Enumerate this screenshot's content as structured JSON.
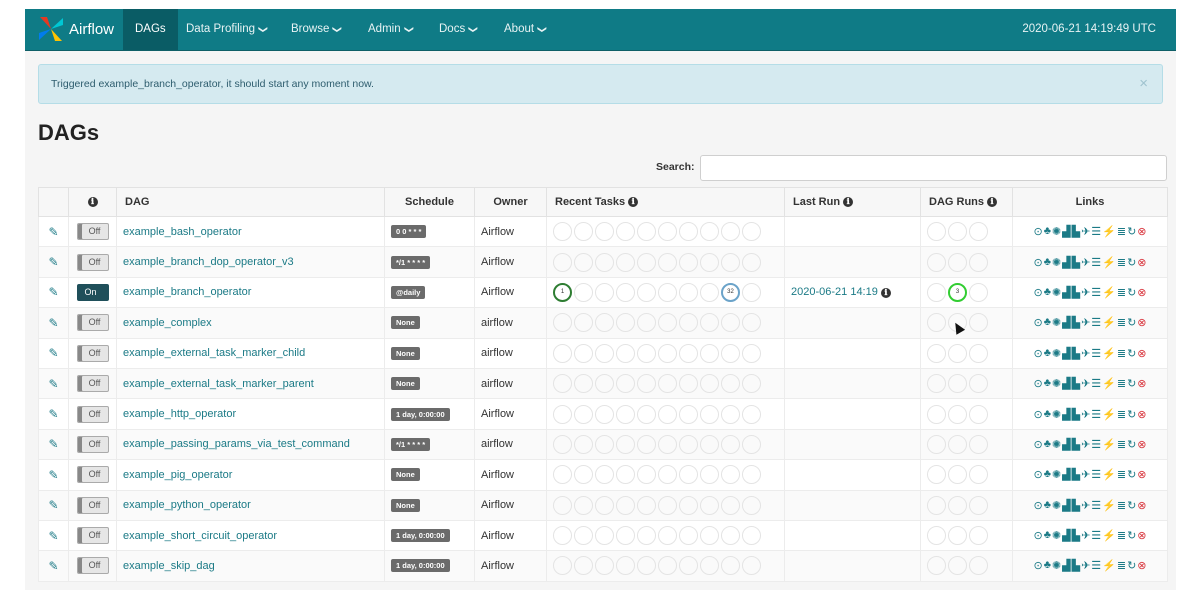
{
  "navbar": {
    "brand": "Airflow",
    "items": [
      {
        "label": "DAGs",
        "caret": ""
      },
      {
        "label": "Data Profiling",
        "caret": "❯"
      },
      {
        "label": "Browse",
        "caret": "❯"
      },
      {
        "label": "Admin",
        "caret": "❯"
      },
      {
        "label": "Docs",
        "caret": "❯"
      },
      {
        "label": "About",
        "caret": "❯"
      }
    ],
    "clock": "2020-06-21 14:19:49 UTC"
  },
  "alert": {
    "message": "Triggered example_branch_operator, it should start any moment now.",
    "close": "×"
  },
  "page_title": "DAGs",
  "search": {
    "label": "Search:",
    "value": ""
  },
  "table": {
    "headers": {
      "info": "ℹ",
      "dag": "DAG",
      "schedule": "Schedule",
      "owner": "Owner",
      "recent_tasks": "Recent Tasks",
      "last_run": "Last Run",
      "dag_runs": "DAG Runs",
      "links": "Links"
    },
    "rows": [
      {
        "toggle": "Off",
        "dag": "example_bash_operator",
        "schedule": "0 0 * * *",
        "owner": "Airflow",
        "last_run": "",
        "tasks": [],
        "runs": []
      },
      {
        "toggle": "Off",
        "dag": "example_branch_dop_operator_v3",
        "schedule": "*/1 * * * *",
        "owner": "Airflow",
        "last_run": "",
        "tasks": [],
        "runs": []
      },
      {
        "toggle": "On",
        "dag": "example_branch_operator",
        "schedule": "@daily",
        "owner": "Airflow",
        "last_run": "2020-06-21 14:19",
        "tasks": [
          {
            "index": 0,
            "value": "1",
            "state": "success"
          },
          {
            "index": 8,
            "value": "32",
            "state": "running"
          }
        ],
        "runs": [
          {
            "index": 1,
            "value": "3",
            "state": "running"
          }
        ]
      },
      {
        "toggle": "Off",
        "dag": "example_complex",
        "schedule": "None",
        "owner": "airflow",
        "last_run": "",
        "tasks": [],
        "runs": []
      },
      {
        "toggle": "Off",
        "dag": "example_external_task_marker_child",
        "schedule": "None",
        "owner": "airflow",
        "last_run": "",
        "tasks": [],
        "runs": []
      },
      {
        "toggle": "Off",
        "dag": "example_external_task_marker_parent",
        "schedule": "None",
        "owner": "airflow",
        "last_run": "",
        "tasks": [],
        "runs": []
      },
      {
        "toggle": "Off",
        "dag": "example_http_operator",
        "schedule": "1 day, 0:00:00",
        "owner": "Airflow",
        "last_run": "",
        "tasks": [],
        "runs": []
      },
      {
        "toggle": "Off",
        "dag": "example_passing_params_via_test_command",
        "schedule": "*/1 * * * *",
        "owner": "airflow",
        "last_run": "",
        "tasks": [],
        "runs": []
      },
      {
        "toggle": "Off",
        "dag": "example_pig_operator",
        "schedule": "None",
        "owner": "Airflow",
        "last_run": "",
        "tasks": [],
        "runs": []
      },
      {
        "toggle": "Off",
        "dag": "example_python_operator",
        "schedule": "None",
        "owner": "Airflow",
        "last_run": "",
        "tasks": [],
        "runs": []
      },
      {
        "toggle": "Off",
        "dag": "example_short_circuit_operator",
        "schedule": "1 day, 0:00:00",
        "owner": "Airflow",
        "last_run": "",
        "tasks": [],
        "runs": []
      },
      {
        "toggle": "Off",
        "dag": "example_skip_dag",
        "schedule": "1 day, 0:00:00",
        "owner": "Airflow",
        "last_run": "",
        "tasks": [],
        "runs": []
      }
    ]
  },
  "link_icons": [
    {
      "name": "trigger-dag-icon",
      "glyph": "⊙"
    },
    {
      "name": "tree-view-icon",
      "glyph": "♣"
    },
    {
      "name": "graph-view-icon",
      "glyph": "✺"
    },
    {
      "name": "duration-chart-icon",
      "glyph": "▟"
    },
    {
      "name": "tries-chart-icon",
      "glyph": "▙"
    },
    {
      "name": "landing-times-icon",
      "glyph": "✈"
    },
    {
      "name": "gantt-icon",
      "glyph": "☰"
    },
    {
      "name": "code-icon",
      "glyph": "⚡"
    },
    {
      "name": "logs-icon",
      "glyph": "≣"
    },
    {
      "name": "refresh-icon",
      "glyph": "↻"
    },
    {
      "name": "delete-icon",
      "glyph": "⊗"
    }
  ],
  "colors": {
    "navbar": "#0f7b86",
    "link": "#1b7a86",
    "success": "#2e7d32",
    "running": "#32cd32",
    "delete": "#d9363e"
  }
}
